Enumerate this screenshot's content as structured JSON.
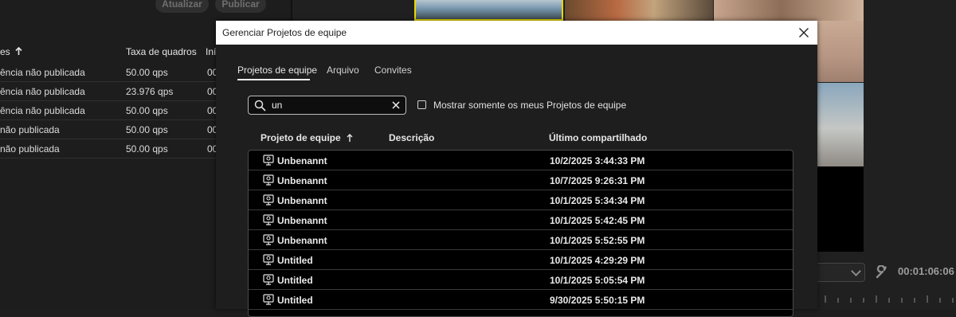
{
  "left_panel": {
    "buttons": {
      "refresh": "Atualizar",
      "publish": "Publicar"
    },
    "headers": {
      "name": "es",
      "frame_rate": "Taxa de quadros",
      "start": "Iní"
    },
    "rows": [
      {
        "name": "ência não publicada",
        "fps": "50.00 qps",
        "start": "00"
      },
      {
        "name": "ência não publicada",
        "fps": "23.976 qps",
        "start": "00"
      },
      {
        "name": "ência não publicada",
        "fps": "50.00 qps",
        "start": "00"
      },
      {
        "name": "não publicada",
        "fps": "50.00 qps",
        "start": "00"
      },
      {
        "name": "não publicada",
        "fps": "50.00 qps",
        "start": "00"
      }
    ]
  },
  "timeline": {
    "timecode": "00:01:06:06"
  },
  "dialog": {
    "title": "Gerenciar Projetos de equipe",
    "tabs": [
      "Projetos de equipe",
      "Arquivo",
      "Convites"
    ],
    "active_tab": "Projetos de equipe",
    "search": {
      "value": "un",
      "placeholder": ""
    },
    "filter_checkbox": {
      "label": "Mostrar somente os meus Projetos de equipe",
      "checked": false
    },
    "columns": {
      "project": "Projeto de equipe",
      "description": "Descrição",
      "last_shared": "Último compartilhado"
    },
    "sort": {
      "column": "Projeto de equipe",
      "direction": "ascending"
    },
    "rows": [
      {
        "name": "Unbenannt",
        "description": "",
        "last_shared": "10/2/2025 3:44:33 PM"
      },
      {
        "name": "Unbenannt",
        "description": "",
        "last_shared": "10/7/2025 9:26:31 PM"
      },
      {
        "name": "Unbenannt",
        "description": "",
        "last_shared": "10/1/2025 5:34:34 PM"
      },
      {
        "name": "Unbenannt",
        "description": "",
        "last_shared": "10/1/2025 5:42:45 PM"
      },
      {
        "name": "Unbenannt",
        "description": "",
        "last_shared": "10/1/2025 5:52:55 PM"
      },
      {
        "name": "Untitled",
        "description": "",
        "last_shared": "10/1/2025 4:29:29 PM"
      },
      {
        "name": "Untitled",
        "description": "",
        "last_shared": "10/1/2025 5:05:54 PM"
      },
      {
        "name": "Untitled",
        "description": "",
        "last_shared": "9/30/2025 5:50:15 PM"
      }
    ]
  },
  "colors": {
    "dialog_bg": "#1e1e1e",
    "table_bg": "#000000",
    "titlebar_bg": "#ffffff",
    "highlight_border": "#e8d800"
  },
  "icons": [
    "search-icon",
    "clear-icon",
    "close-icon",
    "team-project-icon",
    "sort-arrow-icon",
    "wrench-icon",
    "chevron-down-icon"
  ]
}
